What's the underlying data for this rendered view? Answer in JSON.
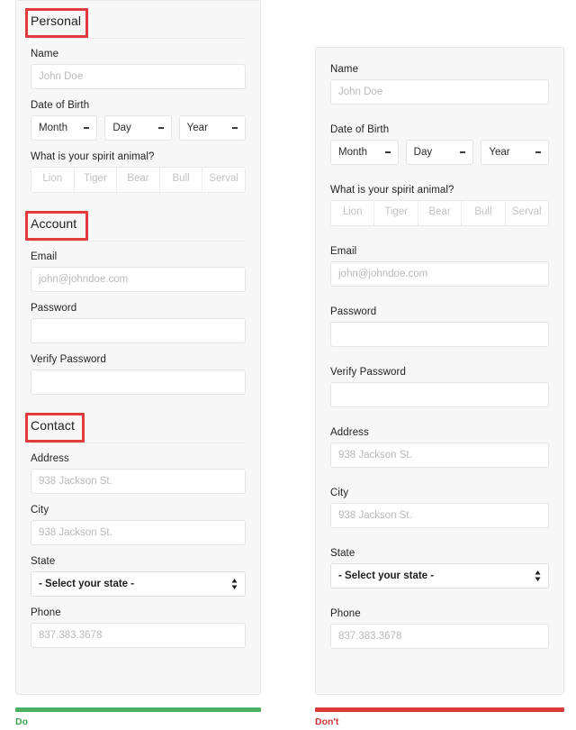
{
  "panels": {
    "do": {
      "sections": [
        {
          "header": "Personal",
          "fields": [
            {
              "kind": "text",
              "label": "Name",
              "placeholder": "John Doe"
            },
            {
              "kind": "dob",
              "label": "Date of Birth",
              "parts": [
                "Month",
                "Day",
                "Year"
              ]
            },
            {
              "kind": "segmented",
              "label": "What is your spirit animal?",
              "options": [
                "Lion",
                "Tiger",
                "Bear",
                "Bull",
                "Serval"
              ]
            }
          ]
        },
        {
          "header": "Account",
          "fields": [
            {
              "kind": "text",
              "label": "Email",
              "placeholder": "john@johndoe.com"
            },
            {
              "kind": "empty",
              "label": "Password",
              "placeholder": ""
            },
            {
              "kind": "empty",
              "label": "Verify Password",
              "placeholder": ""
            }
          ]
        },
        {
          "header": "Contact",
          "fields": [
            {
              "kind": "text",
              "label": "Address",
              "placeholder": "938 Jackson St."
            },
            {
              "kind": "text",
              "label": "City",
              "placeholder": "938 Jackson St."
            },
            {
              "kind": "select",
              "label": "State",
              "value": "- Select your state -"
            },
            {
              "kind": "text",
              "label": "Phone",
              "placeholder": "837.383.3678"
            }
          ]
        }
      ],
      "verdict": {
        "label": "Do",
        "color": "#4caf62"
      }
    },
    "dont": {
      "fields": [
        {
          "kind": "text",
          "label": "Name",
          "placeholder": "John Doe"
        },
        {
          "kind": "dob",
          "label": "Date of Birth",
          "parts": [
            "Month",
            "Day",
            "Year"
          ]
        },
        {
          "kind": "segmented",
          "label": "What is your spirit animal?",
          "options": [
            "Lion",
            "Tiger",
            "Bear",
            "Bull",
            "Serval"
          ]
        },
        {
          "kind": "text",
          "label": "Email",
          "placeholder": "john@johndoe.com"
        },
        {
          "kind": "empty",
          "label": "Password",
          "placeholder": ""
        },
        {
          "kind": "empty",
          "label": "Verify Password",
          "placeholder": ""
        },
        {
          "kind": "text",
          "label": "Address",
          "placeholder": "938 Jackson St."
        },
        {
          "kind": "text",
          "label": "City",
          "placeholder": "938 Jackson St."
        },
        {
          "kind": "select",
          "label": "State",
          "value": "- Select your state -"
        },
        {
          "kind": "text",
          "label": "Phone",
          "placeholder": "837.383.3678"
        }
      ],
      "verdict": {
        "label": "Don't",
        "color": "#d93a3a"
      }
    }
  },
  "annotation": {
    "color": "#e23b3b"
  }
}
